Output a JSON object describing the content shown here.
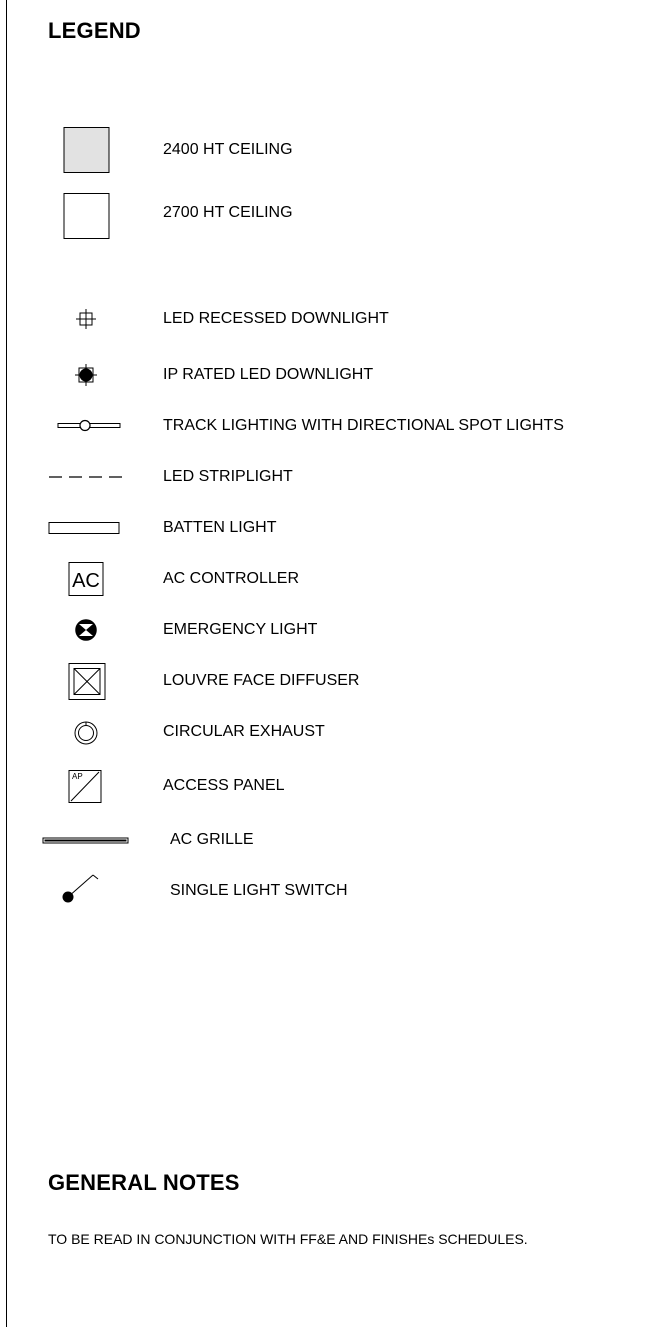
{
  "legend": {
    "title": "LEGEND",
    "items": [
      {
        "icon": "ceiling-2400-swatch-icon",
        "label": "2400 HT CEILING",
        "swatch_color": "#e2e2e2"
      },
      {
        "icon": "ceiling-2700-swatch-icon",
        "label": "2700 HT CEILING",
        "swatch_color": "#ffffff"
      },
      {
        "icon": "led-recessed-downlight-icon",
        "label": "LED RECESSED DOWNLIGHT"
      },
      {
        "icon": "ip-rated-downlight-icon",
        "label": "IP RATED LED DOWNLIGHT"
      },
      {
        "icon": "track-lighting-icon",
        "label": "TRACK LIGHTING WITH DIRECTIONAL SPOT LIGHTS"
      },
      {
        "icon": "led-striplight-icon",
        "label": "LED STRIPLIGHT"
      },
      {
        "icon": "batten-light-icon",
        "label": "BATTEN LIGHT"
      },
      {
        "icon": "ac-controller-icon",
        "label": "AC CONTROLLER",
        "symbol_text": "AC"
      },
      {
        "icon": "emergency-light-icon",
        "label": "EMERGENCY LIGHT"
      },
      {
        "icon": "louvre-face-diffuser-icon",
        "label": "LOUVRE FACE DIFFUSER"
      },
      {
        "icon": "circular-exhaust-icon",
        "label": "CIRCULAR EXHAUST"
      },
      {
        "icon": "access-panel-icon",
        "label": "ACCESS PANEL",
        "symbol_text": "AP"
      },
      {
        "icon": "ac-grille-icon",
        "label": "AC GRILLE"
      },
      {
        "icon": "single-light-switch-icon",
        "label": "SINGLE LIGHT SWITCH"
      }
    ]
  },
  "notes": {
    "title": "GENERAL NOTES",
    "text": "TO BE READ IN CONJUNCTION WITH FF&E AND FINISHEs SCHEDULES."
  }
}
